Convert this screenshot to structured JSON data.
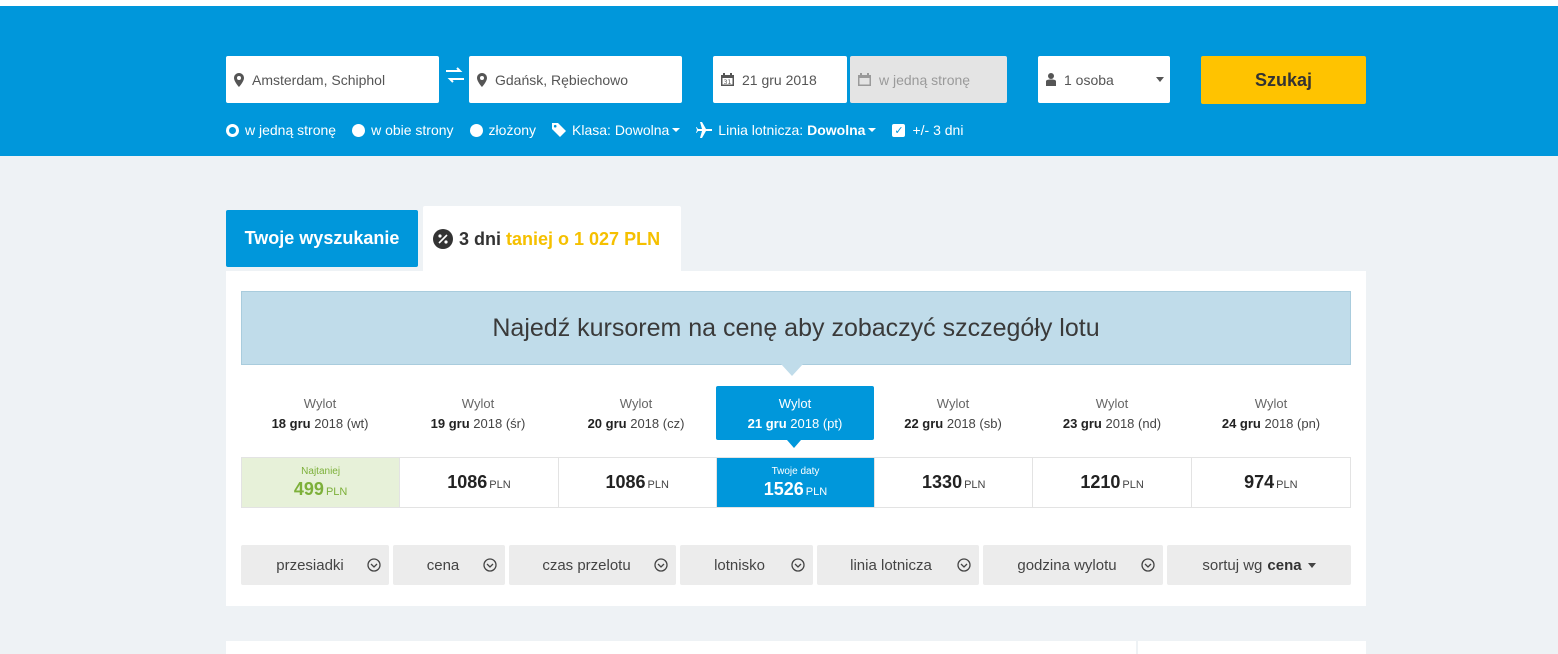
{
  "search": {
    "from": "Amsterdam, Schiphol",
    "to": "Gdańsk, Rębiechowo",
    "depart_date": "21 gru 2018",
    "return_placeholder": "w jedną stronę",
    "passengers": "1 osoba",
    "search_button": "Szukaj"
  },
  "options": {
    "one_way": "w jedną stronę",
    "round_trip": "w obie strony",
    "multi": "złożony",
    "class_label": "Klasa: Dowolna",
    "airline_label": "Linia lotnicza:",
    "airline_value": "Dowolna",
    "flex_days": "+/- 3 dni"
  },
  "tabs": {
    "your_search": "Twoje wyszukanie",
    "cheaper_prefix": "3 dni",
    "cheaper_text": "taniej o 1 027 PLN"
  },
  "banner": "Najedź kursorem na cenę aby zobaczyć szczegóły lotu",
  "dates": [
    {
      "label": "Wylot",
      "day": "18 gru",
      "rest": "2018 (wt)"
    },
    {
      "label": "Wylot",
      "day": "19 gru",
      "rest": "2018 (śr)"
    },
    {
      "label": "Wylot",
      "day": "20 gru",
      "rest": "2018 (cz)"
    },
    {
      "label": "Wylot",
      "day": "21 gru",
      "rest": "2018 (pt)"
    },
    {
      "label": "Wylot",
      "day": "22 gru",
      "rest": "2018 (sb)"
    },
    {
      "label": "Wylot",
      "day": "23 gru",
      "rest": "2018 (nd)"
    },
    {
      "label": "Wylot",
      "day": "24 gru",
      "rest": "2018 (pn)"
    }
  ],
  "prices": [
    {
      "tag": "Najtaniej",
      "amount": "499",
      "currency": "PLN"
    },
    {
      "tag": "",
      "amount": "1086",
      "currency": "PLN"
    },
    {
      "tag": "",
      "amount": "1086",
      "currency": "PLN"
    },
    {
      "tag": "Twoje daty",
      "amount": "1526",
      "currency": "PLN"
    },
    {
      "tag": "",
      "amount": "1330",
      "currency": "PLN"
    },
    {
      "tag": "",
      "amount": "1210",
      "currency": "PLN"
    },
    {
      "tag": "",
      "amount": "974",
      "currency": "PLN"
    }
  ],
  "filters": {
    "stops": "przesiadki",
    "price": "cena",
    "duration": "czas przelotu",
    "airport": "lotnisko",
    "airline": "linia lotnicza",
    "departure_time": "godzina wylotu",
    "sort_prefix": "sortuj wg",
    "sort_value": "cena"
  },
  "colors": {
    "header_blue": "#0097db",
    "search_yellow": "#ffc300",
    "cheapest_green": "#7db03a",
    "cheaper_yellow": "#f5c000"
  }
}
